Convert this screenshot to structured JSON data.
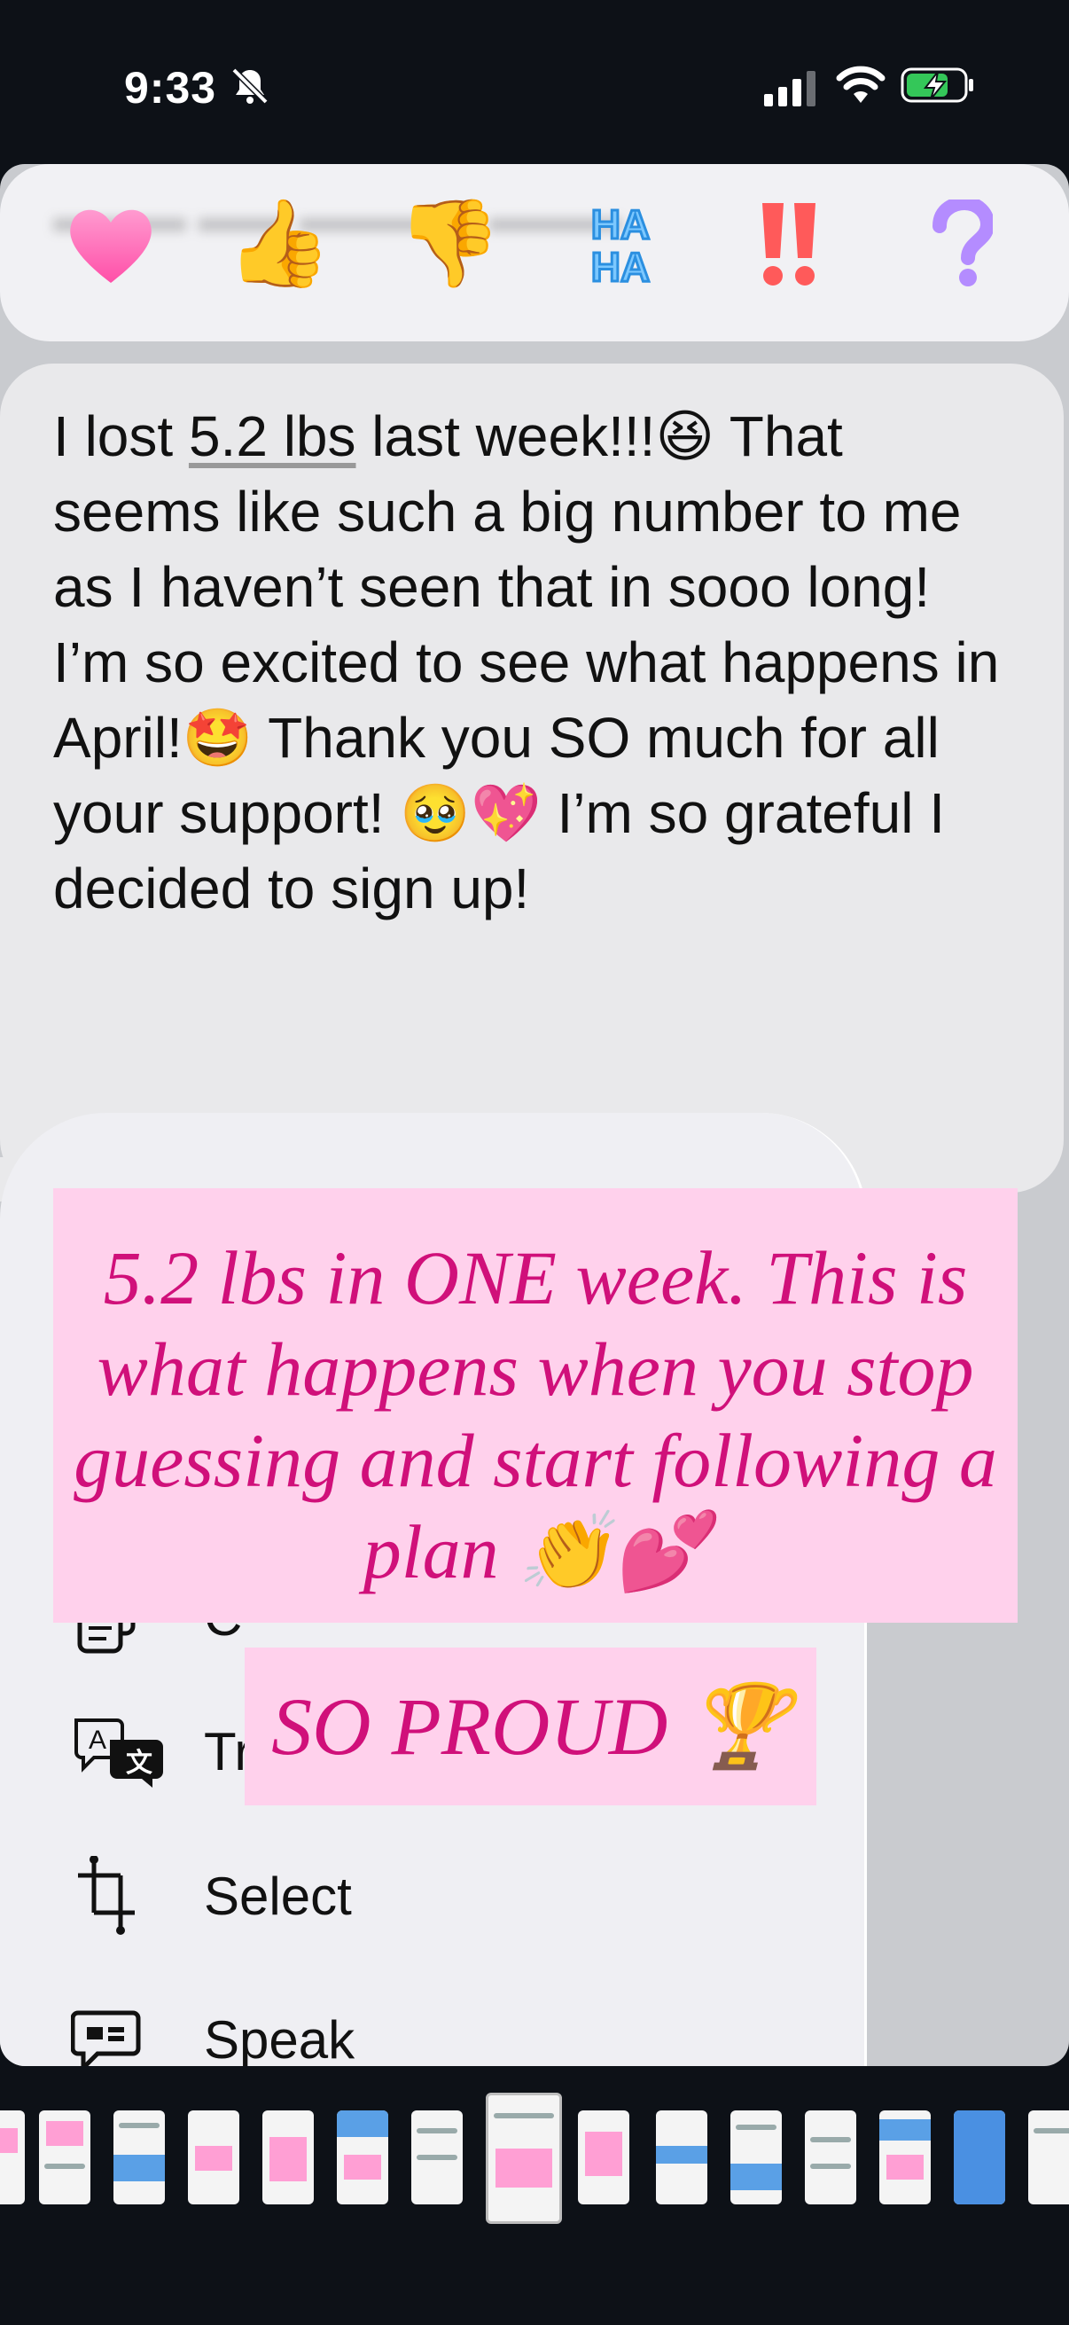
{
  "status": {
    "time": "9:33"
  },
  "tapbacks": [
    {
      "name": "heart",
      "glyph": "❤️"
    },
    {
      "name": "thumbs-up",
      "glyph": "👍"
    },
    {
      "name": "thumbs-down",
      "glyph": "👎"
    },
    {
      "name": "haha",
      "glyph": "HA HA"
    },
    {
      "name": "emphasis",
      "glyph": "‼️"
    },
    {
      "name": "question",
      "glyph": "❓"
    }
  ],
  "message": {
    "part1": "I lost ",
    "highlight": "5.2 lbs",
    "part2": " last week!!!😆 That seems like such a big number to me as I haven’t seen that in sooo long! I’m so excited to see what happens in April!🤩 Thank you SO much for all your support! 🥹💖 I’m so grateful I decided to sign up!"
  },
  "overlays": {
    "caption1": "5.2 lbs in ONE week. This is what happens when you stop guessing and start following a plan 👏💕",
    "caption2": "SO PROUD 🏆"
  },
  "menu": {
    "copy_partial": "C",
    "translate": "Translate",
    "select": "Select",
    "speak": "Speak"
  },
  "colors": {
    "overlay_bg": "#ffd1ec",
    "overlay_text": "#d0107a",
    "bubble_bg": "#e9e9eb"
  }
}
